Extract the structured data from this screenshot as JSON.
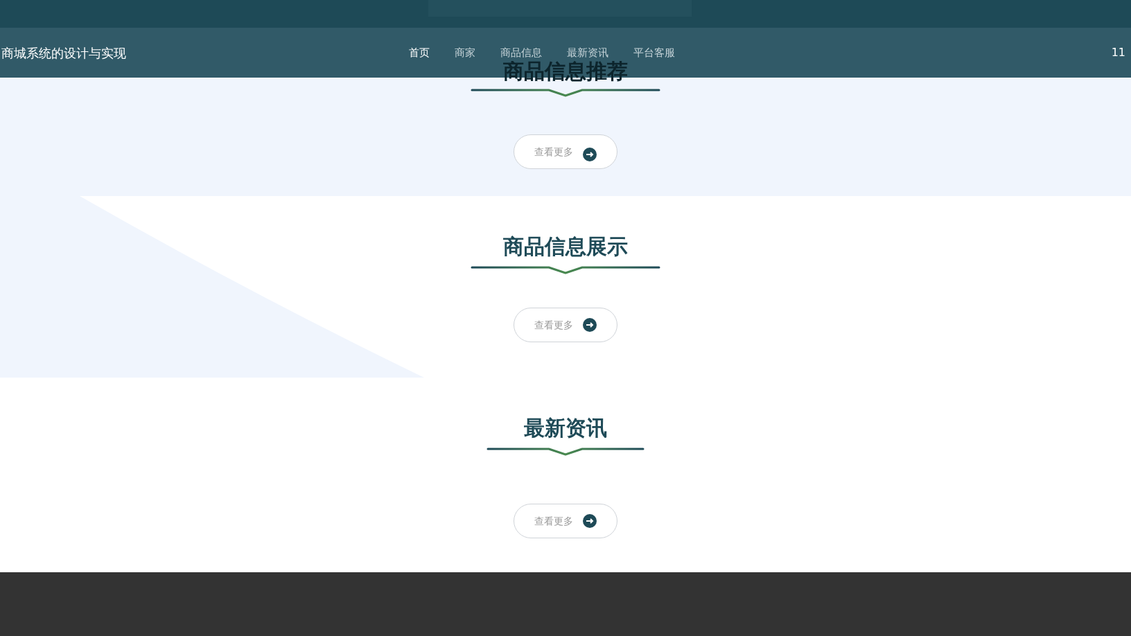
{
  "navbar": {
    "title": "商城系统的设计与实现",
    "nav": [
      {
        "label": "首页",
        "selected": true
      },
      {
        "label": "商家",
        "selected": false
      },
      {
        "label": "商品信息",
        "selected": false
      },
      {
        "label": "最新资讯",
        "selected": false
      },
      {
        "label": "平台客服",
        "selected": false
      }
    ],
    "user": "11"
  },
  "sections": [
    {
      "kind": "band",
      "title": "商品信息推荐",
      "button": "查看更多"
    },
    {
      "kind": "wedge",
      "title": "商品信息展示",
      "button": "查看更多"
    },
    {
      "kind": "plain",
      "title": "最新资讯",
      "button": "查看更多"
    }
  ]
}
